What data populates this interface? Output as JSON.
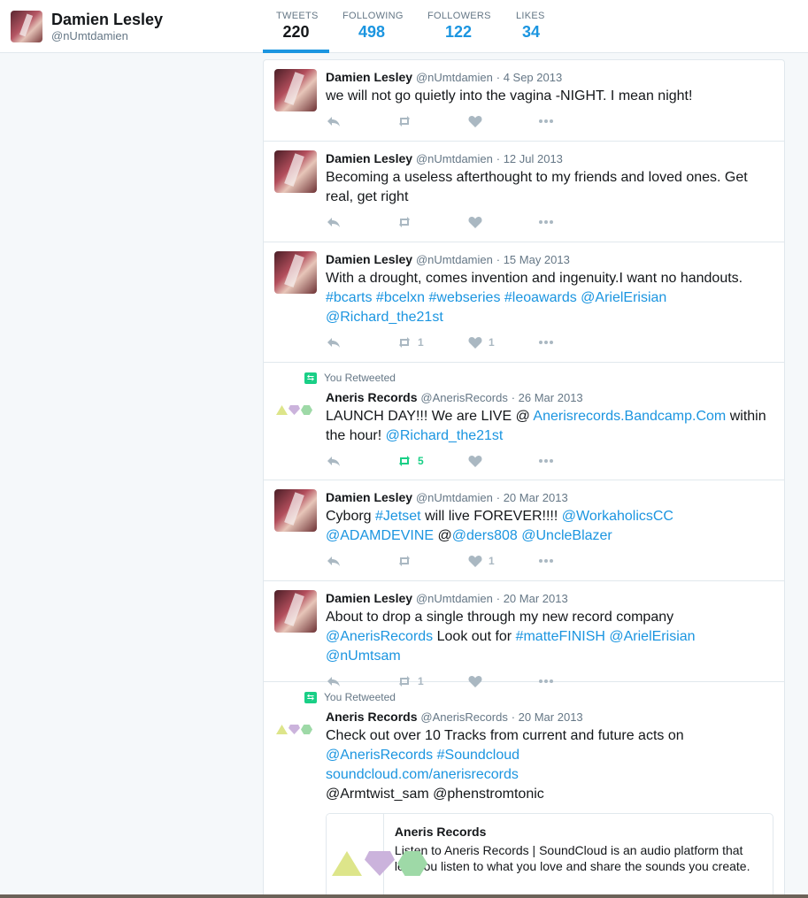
{
  "profile": {
    "name": "Damien Lesley",
    "handle": "@nUmtdamien"
  },
  "stats": [
    {
      "label": "TWEETS",
      "value": "220"
    },
    {
      "label": "FOLLOWING",
      "value": "498"
    },
    {
      "label": "FOLLOWERS",
      "value": "122"
    },
    {
      "label": "LIKES",
      "value": "34"
    }
  ],
  "colors": {
    "link": "#1b95e0",
    "retweet_green": "#19cf86",
    "muted": "#657786",
    "icon": "#aab8c2"
  },
  "tweets": [
    {
      "author": "Damien Lesley",
      "handle": "@nUmtdamien",
      "date": "· 4 Sep 2013",
      "text": "we will not go quietly into the vagina -NIGHT. I mean night!",
      "retweets": "",
      "likes": ""
    },
    {
      "author": "Damien Lesley",
      "handle": "@nUmtdamien",
      "date": "· 12 Jul 2013",
      "text": "Becoming a useless afterthought to my friends and loved ones. Get real, get right",
      "retweets": "",
      "likes": ""
    },
    {
      "author": "Damien Lesley",
      "handle": "@nUmtdamien",
      "date": "· 15 May 2013",
      "text_plain": "With a drought, comes invention and ingenuity.I want no handouts.",
      "text_links": "#bcarts #bcelxn #webseries #leoawards @ArielErisian @Richard_the21st",
      "retweets": "1",
      "likes": "1"
    },
    {
      "context": "You Retweeted",
      "author": "Aneris Records",
      "handle": "@AnerisRecords",
      "date": "· 26 Mar 2013",
      "text_a": "LAUNCH DAY!!! We are LIVE @",
      "link_a": "Anerisrecords.Bandcamp.Com",
      "text_b": "within the hour!",
      "link_b": "@Richard_the21st",
      "retweets": "5",
      "likes": ""
    },
    {
      "author": "Damien Lesley",
      "handle": "@nUmtdamien",
      "date": "· 20 Mar 2013",
      "text_a": "Cyborg",
      "link_a": "#Jetset",
      "text_b": "will live FOREVER!!!!",
      "link_b": "@WorkaholicsCC @ADAMDEVINE",
      "text_c": "@",
      "link_c": "@ders808 @UncleBlazer",
      "retweets": "",
      "likes": "1"
    },
    {
      "author": "Damien Lesley",
      "handle": "@nUmtdamien",
      "date": "· 20 Mar 2013",
      "text_a": "About to drop a single through my new record company",
      "link_a": "@AnerisRecords",
      "text_b": "Look out for",
      "link_b": "#matteFINISH @ArielErisian @nUmtsam",
      "retweets": "1",
      "likes": ""
    },
    {
      "context": "You Retweeted",
      "author": "Aneris Records",
      "handle": "@AnerisRecords",
      "date": "· 20 Mar 2013",
      "text_a": "Check out over 10 Tracks from current and future acts on",
      "link_a": "@AnerisRecords #Soundcloud",
      "link_b": "soundcloud.com/anerisrecords",
      "text_b": "@Armtwist_sam @phenstromtonic",
      "card": {
        "title": "Aneris Records",
        "description": "Listen to Aneris Records | SoundCloud is an audio platform that lets you listen to what you love and share the sounds you create."
      }
    }
  ]
}
